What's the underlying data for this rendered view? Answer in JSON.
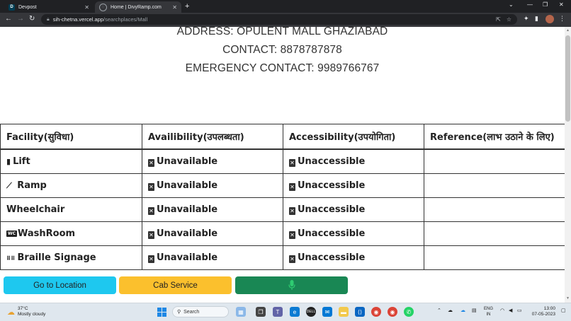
{
  "browser": {
    "tabs": [
      {
        "title": "Devpost",
        "favicon": "D"
      },
      {
        "title": "Home | DivyRamp.com",
        "favicon": "globe-icon"
      }
    ],
    "url_host": "sih-chetna.vercel.app",
    "url_path": "/searchplaces/Mall"
  },
  "info": {
    "address": "ADDRESS: OPULENT MALL GHAZIABAD",
    "contact": "CONTACT: 8878787878",
    "emergency": "EMERGENCY CONTACT: 9989766767"
  },
  "table": {
    "headers": [
      "Facility(सुविधा)",
      "Availibility(उपलब्धता)",
      "Accessibility(उपयोगिता)",
      "Reference(लाभ उठाने के लिए)"
    ],
    "rows": [
      {
        "facility": "Lift",
        "icon": "door-icon",
        "availability": "Unavailable",
        "accessibility": "Unaccessible",
        "reference": ""
      },
      {
        "facility": " Ramp",
        "icon": "ramp-icon",
        "availability": "Unavailable",
        "accessibility": "Unaccessible",
        "reference": ""
      },
      {
        "facility": "Wheelchair",
        "icon": "",
        "availability": "Unavailable",
        "accessibility": "Unaccessible",
        "reference": ""
      },
      {
        "facility": "WashRoom",
        "icon": "wc-icon",
        "availability": "Unavailable",
        "accessibility": "Unaccessible",
        "reference": ""
      },
      {
        "facility": "Braille Signage",
        "icon": "braille-icon",
        "availability": "Unavailable",
        "accessibility": "Unaccessible",
        "reference": ""
      }
    ]
  },
  "buttons": {
    "location": "Go to Location",
    "cab": "Cab Service",
    "mic_icon": "microphone-icon"
  },
  "colors": {
    "location_button": "#1ec8ef",
    "cab_button": "#fbc02d",
    "mic_button": "#198754"
  },
  "taskbar": {
    "temperature": "37°C",
    "weather": "Mostly cloudy",
    "search_placeholder": "Search",
    "lang_top": "ENG",
    "lang_bottom": "IN",
    "time": "13:00",
    "date": "07-05-2023"
  }
}
